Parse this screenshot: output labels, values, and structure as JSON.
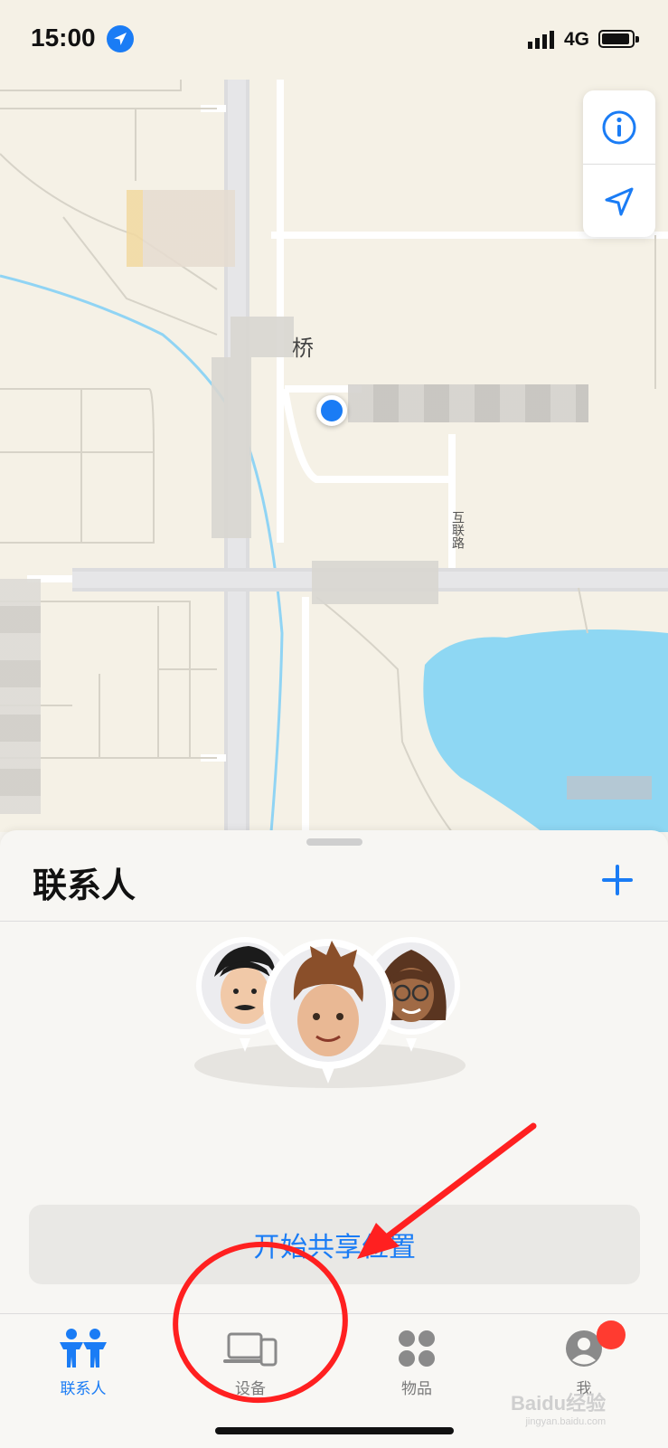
{
  "status_bar": {
    "time": "15:00",
    "network": "4G"
  },
  "map": {
    "place_label": "桥",
    "road_label": "互联路"
  },
  "sheet": {
    "title": "联系人",
    "share_button": "开始共享位置"
  },
  "tabs": [
    {
      "label": "联系人",
      "active": true
    },
    {
      "label": "设备",
      "active": false
    },
    {
      "label": "物品",
      "active": false
    },
    {
      "label": "我",
      "active": false
    }
  ],
  "watermark": {
    "brand": "Baidu经验",
    "url": "jingyan.baidu.com"
  },
  "colors": {
    "accent": "#1a7cf5",
    "annotation": "#ff2020",
    "water": "#8ed7f3",
    "badge": "#ff3b30"
  }
}
